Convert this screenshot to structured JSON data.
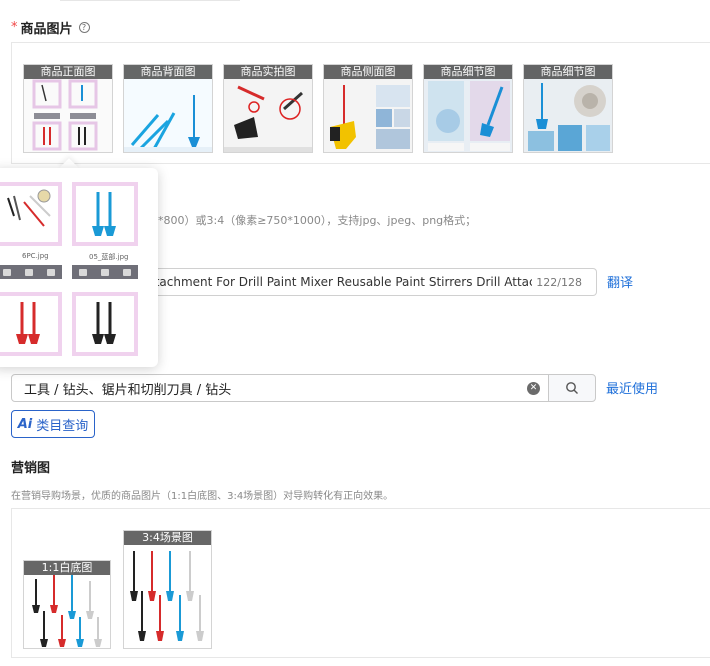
{
  "product_images": {
    "required_mark": "*",
    "title": "商品图片",
    "help_icon": "question-circle-icon",
    "slots": [
      {
        "label": "商品正面图"
      },
      {
        "label": "商品背面图"
      },
      {
        "label": "商品实拍图"
      },
      {
        "label": "商品侧面图"
      },
      {
        "label": "商品细节图"
      },
      {
        "label": "商品细节图"
      }
    ],
    "hint": "00*800）或3:4（像素≥750*1000），支持jpg、jpeg、png格式；"
  },
  "popover": {
    "images": [
      {
        "name": "6PC.jpg"
      },
      {
        "name": "05_蓝部.jpg"
      },
      {
        "name": ""
      },
      {
        "name": ""
      }
    ],
    "action_icons": [
      "view-icon",
      "link-icon",
      "delete-icon"
    ]
  },
  "title_field": {
    "value": "ttachment For Drill Paint Mixer Reusable Paint Stirrers Drill Attachme",
    "counter": "122/128",
    "translate_label": "翻译"
  },
  "category": {
    "value": "工具 / 钻头、锯片和切削刀具 / 钻头",
    "recent_label": "最近使用",
    "ai_glyph": "Ai",
    "ai_label": "类目查询"
  },
  "marketing": {
    "title": "营销图",
    "hint": "在营销导购场景，优质的商品图片（1:1白底图、3:4场景图）对导购转化有正向效果。",
    "images": [
      {
        "label": "1:1白底图"
      },
      {
        "label": "3:4场景图"
      }
    ]
  },
  "colors": {
    "link": "#1e6fd9",
    "accent": "#2a63c9",
    "required": "#f04545"
  }
}
